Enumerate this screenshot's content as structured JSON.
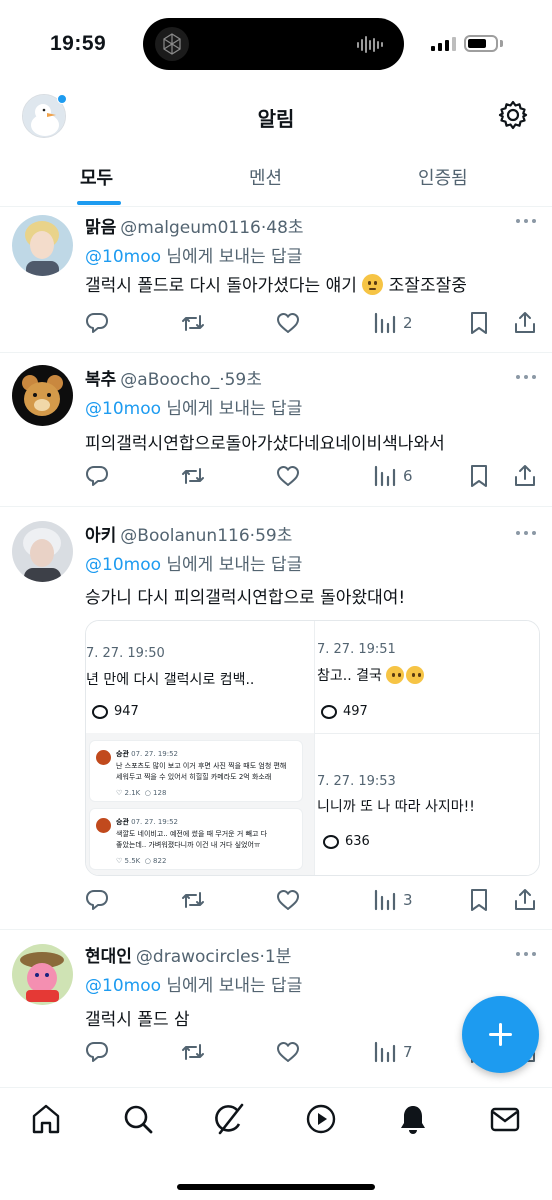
{
  "status_bar": {
    "time": "19:59"
  },
  "header": {
    "title": "알림"
  },
  "tabs": [
    {
      "label": "모두",
      "active": true
    },
    {
      "label": "멘션",
      "active": false
    },
    {
      "label": "인증됨",
      "active": false
    }
  ],
  "reply_to": {
    "mention": "@10moo",
    "suffix": " 님에게 보내는 답글"
  },
  "tweets": [
    {
      "name": "맑음",
      "handle": "@malgeum0116",
      "time": "·48초",
      "text": "갤럭시 폴드로 다시 돌아가셨다는 얘기",
      "text_after_emoji": "조잘조잘중",
      "views": "2"
    },
    {
      "name": "복추",
      "handle": "@aBoocho_",
      "time": "·59초",
      "text": "피의갤럭시연합으로돌아가샸다네요네이비색나와서",
      "views": "6"
    },
    {
      "name": "아키",
      "handle": "@Boolanun116",
      "time": "·59초",
      "text": "승가니 다시 피의갤럭시연합으로 돌아왔대여!",
      "views": "3"
    },
    {
      "name": "현대인",
      "handle": "@drawocircles",
      "time": "·1분",
      "text": "갤럭시 폴드 삼",
      "views": "7"
    }
  ],
  "media": {
    "a": {
      "date": "7. 27. 19:50",
      "text": "년 만에 다시 갤럭시로 컴백..",
      "count": "947"
    },
    "b": {
      "date": "7. 27. 19:51",
      "text": "참고.. 결국",
      "count": "497"
    },
    "c": {
      "date": "7. 27. 19:53",
      "text": "니니까 또 나 따라 사지마!!",
      "count": "636"
    },
    "mini1": {
      "name": "승관",
      "date": "07. 27. 19:52",
      "line1": "난 스포츠도 많이 보고 이거 후면 사진 찍을 때도 엄청 편해",
      "line2": "세워두고 찍을 수 있어서 히힐힐 카메라도 2억 화소래",
      "likes": "2.1K",
      "replies": "128"
    },
    "mini2": {
      "name": "승관",
      "date": "07. 27. 19:52",
      "line1": "색깔도 네이비고.. 예전에 썼을 때 무거운 거 빼고 다",
      "line2": "좋았는데.. 가벼워졌다니까 이건 내 거다 싶었어ㅠ",
      "likes": "5.5K",
      "replies": "822"
    }
  },
  "icons": {
    "settings": "gear-icon",
    "reply": "comment-icon",
    "retweet": "retweet-icon",
    "like": "heart-icon",
    "views": "bar-chart-icon",
    "bookmark": "bookmark-icon",
    "share": "share-icon",
    "compose": "plus-icon",
    "nav": [
      "home-icon",
      "search-icon",
      "grok-icon",
      "play-icon",
      "bell-icon",
      "mail-icon"
    ]
  },
  "colors": {
    "accent": "#1d9bf0",
    "text": "#0f1419",
    "secondary": "#536471"
  }
}
